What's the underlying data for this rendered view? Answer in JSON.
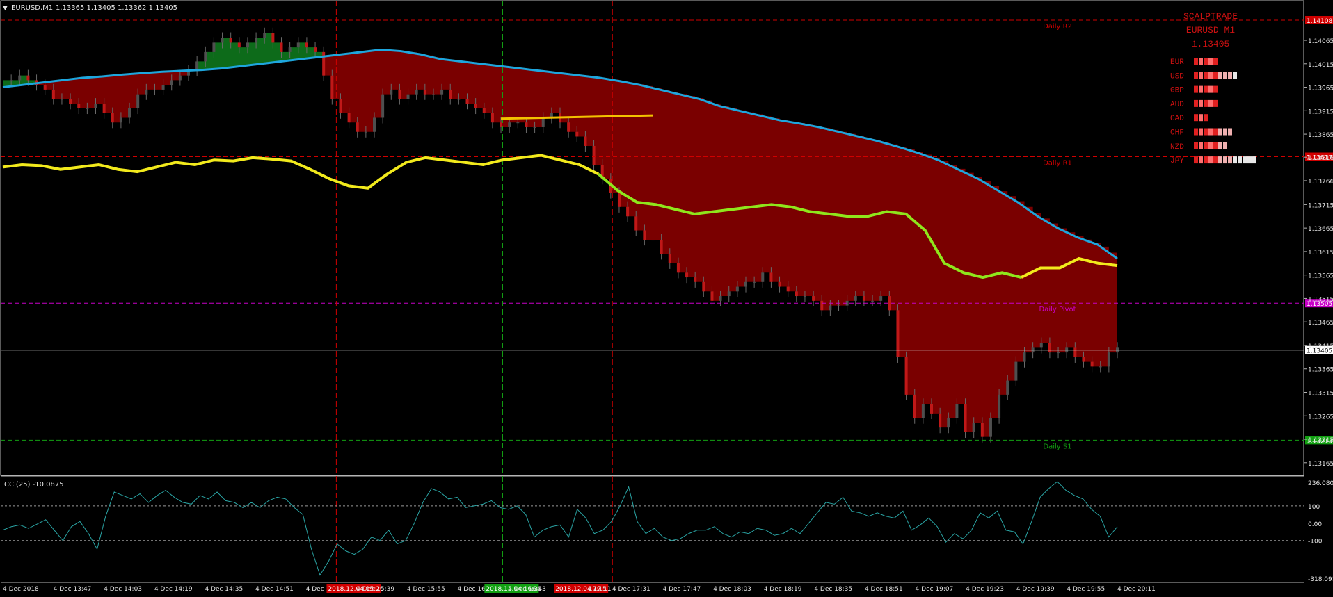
{
  "window": {
    "symbol_label": "EURUSD,M1",
    "ohlc": "1.13365 1.13405 1.13362 1.13405"
  },
  "colors": {
    "background": "#000000",
    "up_cloud": "#0d6b1a",
    "down_cloud": "#7a0000",
    "ma_slow": "#1ea6dd",
    "ma_fast_up": "#f2ea1c",
    "ma_fast_down": "#8fe61c",
    "trendline": "#f2c200",
    "pivot": "#c800c8",
    "resistance": "#d00000",
    "support": "#12a012",
    "cci": "#2aa4a4",
    "axis_text": "#e6e6e6"
  },
  "overlay_panel": {
    "title": "SCALPTRADE",
    "symbol": "EURUSD M1",
    "price": "1.13405",
    "currencies": [
      {
        "code": "EUR",
        "strength": 5
      },
      {
        "code": "USD",
        "strength": 9
      },
      {
        "code": "GBP",
        "strength": 5
      },
      {
        "code": "AUD",
        "strength": 5
      },
      {
        "code": "CAD",
        "strength": 3
      },
      {
        "code": "CHF",
        "strength": 8
      },
      {
        "code": "NZD",
        "strength": 7
      },
      {
        "code": "JPY",
        "strength": 13
      }
    ]
  },
  "levels": [
    {
      "label": "Daily R2",
      "price": 1.14108,
      "price_label": "1.14108",
      "color": "#d00000"
    },
    {
      "label": "Daily R1",
      "price": 1.13817,
      "price_label": "1.13817",
      "color": "#d00000"
    },
    {
      "label": "Daily Pivot",
      "price": 1.13505,
      "price_label": "1.13505",
      "color": "#c800c8"
    },
    {
      "label": "Daily S1",
      "price": 1.13213,
      "price_label": "1.13213",
      "color": "#12a012"
    }
  ],
  "current_price": {
    "price": 1.13405,
    "label": "1.13405"
  },
  "vertical_markers": [
    {
      "time": "2018.12.04 15:20",
      "color": "#d00000"
    },
    {
      "time": "2018.12.04 16:31",
      "color": "#12a012"
    },
    {
      "time": "2018.12.04 17:11",
      "color": "#d00000"
    }
  ],
  "chart_data": {
    "type": "line",
    "title": "EURUSD,M1",
    "price_axis_ticks": [
      "1.14065",
      "1.14015",
      "1.13965",
      "1.13915",
      "1.13865",
      "1.13816",
      "1.13766",
      "1.13715",
      "1.13665",
      "1.13615",
      "1.13565",
      "1.13515",
      "1.13465",
      "1.13415",
      "1.13365",
      "1.13315",
      "1.13265",
      "1.13215",
      "1.13165"
    ],
    "ylim": [
      1.13141,
      1.14145
    ],
    "time_axis_labels": [
      "4 Dec 2018",
      "4 Dec 13:47",
      "4 Dec 14:03",
      "4 Dec 14:19",
      "4 Dec 14:35",
      "4 Dec 14:51",
      "4 Dec 15:07",
      "2018.12.04 15:20",
      "4 Dec 15:39",
      "4 Dec 15:55",
      "4 Dec 16:",
      "2018.12.04 16:31",
      "4 Dec 16:43",
      "4",
      "2018.12.04 17:11",
      "17:15",
      "4 Dec 17:31",
      "4 Dec 17:47",
      "4 Dec 18:03",
      "4 Dec 18:19",
      "4 Dec 18:35",
      "4 Dec 18:51",
      "4 Dec 19:07",
      "4 Dec 19:23",
      "4 Dec 19:39",
      "4 Dec 19:55",
      "4 Dec 20:11"
    ],
    "price_minutes": [
      0,
      10,
      20,
      30,
      40,
      50,
      60,
      70,
      80,
      90,
      100,
      110,
      120,
      130,
      140,
      150,
      160,
      170,
      180,
      190,
      200,
      210,
      220,
      230,
      240,
      250,
      260,
      270,
      280,
      290,
      300,
      310,
      320,
      330,
      340,
      350,
      360,
      370,
      380,
      390,
      400,
      410,
      420,
      430,
      440,
      450,
      460,
      470,
      480,
      490,
      500,
      510,
      520,
      530,
      540,
      550,
      560,
      570,
      580,
      590,
      600,
      610,
      620,
      630,
      640,
      650,
      660,
      670,
      680,
      690,
      700,
      710,
      720,
      730,
      740,
      750,
      760,
      770,
      780,
      790,
      800,
      810,
      820,
      830,
      840,
      850,
      860,
      870,
      880,
      890,
      900,
      910,
      920,
      930,
      940,
      950,
      960,
      970,
      980,
      990,
      1000,
      1010,
      1020,
      1030,
      1040,
      1050,
      1060,
      1070,
      1080,
      1090,
      1100,
      1110,
      1120,
      1130,
      1140,
      1150,
      1160,
      1170,
      1180,
      1190,
      1200,
      1210,
      1220,
      1230,
      1240,
      1250,
      1260,
      1270,
      1280,
      1290,
      1300,
      1310,
      1320
    ],
    "series": [
      {
        "name": "EURUSD close",
        "values": [
          1.1398,
          1.1398,
          1.1399,
          1.1398,
          1.1397,
          1.1396,
          1.1394,
          1.1394,
          1.1393,
          1.1392,
          1.1392,
          1.1393,
          1.1391,
          1.1389,
          1.139,
          1.1392,
          1.1395,
          1.1396,
          1.1396,
          1.1397,
          1.1398,
          1.1399,
          1.14,
          1.1402,
          1.1404,
          1.1406,
          1.1407,
          1.1406,
          1.1405,
          1.1406,
          1.1407,
          1.1408,
          1.1406,
          1.1404,
          1.1405,
          1.1406,
          1.1405,
          1.1404,
          1.1399,
          1.1394,
          1.1391,
          1.1389,
          1.1387,
          1.1387,
          1.139,
          1.1395,
          1.1396,
          1.1394,
          1.1395,
          1.1396,
          1.1395,
          1.1395,
          1.1396,
          1.1394,
          1.1394,
          1.1393,
          1.1392,
          1.1391,
          1.1389,
          1.1388,
          1.1389,
          1.1389,
          1.1388,
          1.1388,
          1.139,
          1.1391,
          1.1389,
          1.1387,
          1.1386,
          1.1384,
          1.138,
          1.1377,
          1.1374,
          1.1371,
          1.1369,
          1.1366,
          1.1364,
          1.1364,
          1.1361,
          1.1359,
          1.1357,
          1.1356,
          1.1355,
          1.1353,
          1.1351,
          1.1352,
          1.1353,
          1.1354,
          1.1355,
          1.1355,
          1.1357,
          1.1355,
          1.1354,
          1.1353,
          1.1352,
          1.1352,
          1.1351,
          1.1349,
          1.135,
          1.135,
          1.1351,
          1.1352,
          1.1351,
          1.1351,
          1.1352,
          1.1349,
          1.1339,
          1.1331,
          1.1326,
          1.1329,
          1.1327,
          1.1324,
          1.1326,
          1.1329,
          1.1323,
          1.1325,
          1.1322,
          1.1326,
          1.1331,
          1.1334,
          1.1338,
          1.134,
          1.1341,
          1.1342,
          1.134,
          1.134,
          1.1341,
          1.1339,
          1.1338,
          1.1337,
          1.1337,
          1.134,
          1.1341
        ]
      },
      {
        "name": "Slow MA",
        "values": [
          1.13965,
          1.1397,
          1.13975,
          1.1398,
          1.13985,
          1.13988,
          1.13992,
          1.13995,
          1.13998,
          1.14,
          1.14002,
          1.14005,
          1.1401,
          1.14015,
          1.1402,
          1.14025,
          1.1403,
          1.14035,
          1.1404,
          1.14045,
          1.14042,
          1.14035,
          1.14025,
          1.1402,
          1.14015,
          1.1401,
          1.14005,
          1.14,
          1.13995,
          1.1399,
          1.13985,
          1.13978,
          1.1397,
          1.1396,
          1.1395,
          1.1394,
          1.13925,
          1.13915,
          1.13905,
          1.13895,
          1.13888,
          1.1388,
          1.1387,
          1.1386,
          1.1385,
          1.13838,
          1.13825,
          1.1381,
          1.1379,
          1.1377,
          1.13745,
          1.1372,
          1.1369,
          1.13665,
          1.13645,
          1.1363,
          1.136
        ]
      },
      {
        "name": "Fast MA",
        "values": [
          1.13795,
          1.138,
          1.13798,
          1.1379,
          1.13795,
          1.138,
          1.1379,
          1.13785,
          1.13795,
          1.13805,
          1.138,
          1.1381,
          1.13808,
          1.13815,
          1.13812,
          1.13808,
          1.1379,
          1.1377,
          1.13755,
          1.1375,
          1.1378,
          1.13805,
          1.13815,
          1.1381,
          1.13805,
          1.138,
          1.1381,
          1.13815,
          1.1382,
          1.1381,
          1.138,
          1.1378,
          1.13745,
          1.1372,
          1.13715,
          1.13705,
          1.13695,
          1.137,
          1.13705,
          1.1371,
          1.13715,
          1.1371,
          1.137,
          1.13695,
          1.1369,
          1.1369,
          1.137,
          1.13695,
          1.1366,
          1.1359,
          1.1357,
          1.1356,
          1.1357,
          1.1356,
          1.1358,
          1.1358,
          1.136,
          1.1359,
          1.13585
        ]
      }
    ],
    "cci": {
      "label": "CCI(25) -10.0875",
      "axis_labels": [
        "236.0802",
        "100",
        "0.00",
        "-100",
        "-318.0918"
      ],
      "ylim": [
        -318.0918,
        236.0802
      ],
      "levels": [
        100,
        -100
      ],
      "values": [
        -40,
        -20,
        -10,
        -30,
        -5,
        20,
        -40,
        -100,
        -20,
        10,
        -60,
        -150,
        40,
        180,
        160,
        140,
        170,
        120,
        160,
        190,
        150,
        120,
        110,
        160,
        140,
        180,
        130,
        120,
        90,
        120,
        90,
        130,
        150,
        140,
        90,
        50,
        -150,
        -300,
        -220,
        -120,
        -160,
        -180,
        -150,
        -80,
        -100,
        -40,
        -120,
        -100,
        0,
        120,
        200,
        180,
        140,
        150,
        90,
        100,
        110,
        130,
        90,
        80,
        100,
        50,
        -80,
        -40,
        -20,
        -10,
        -80,
        80,
        30,
        -60,
        -40,
        10,
        100,
        210,
        10,
        -60,
        -30,
        -80,
        -100,
        -90,
        -60,
        -40,
        -40,
        -20,
        -60,
        -80,
        -50,
        -60,
        -30,
        -40,
        -70,
        -60,
        -30,
        -60,
        0,
        60,
        120,
        110,
        150,
        70,
        60,
        40,
        60,
        40,
        30,
        70,
        -40,
        -10,
        30,
        -20,
        -110,
        -60,
        -90,
        -40,
        60,
        30,
        70,
        -40,
        -50,
        -120,
        10,
        150,
        200,
        240,
        190,
        160,
        140,
        80,
        40,
        -80,
        -20
      ]
    }
  }
}
